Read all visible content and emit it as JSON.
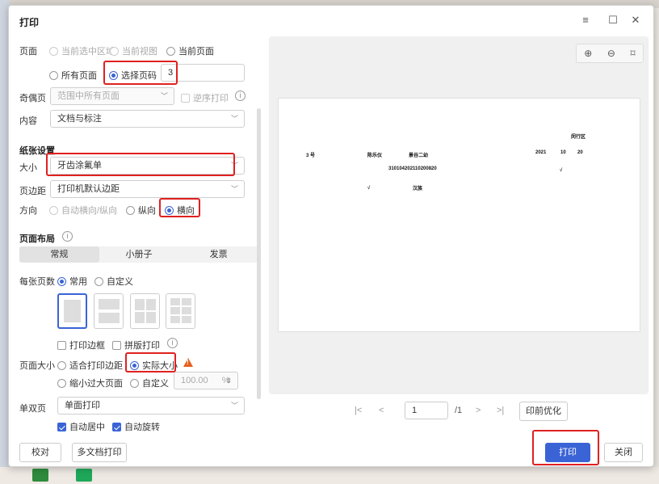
{
  "dialog": {
    "title": "打印",
    "menu_icon": "≡",
    "max_icon": "☐",
    "close_icon": "✕"
  },
  "page_range": {
    "label": "页面",
    "opt_selected_area": "当前选中区域",
    "opt_current_view": "当前视图",
    "opt_current_page": "当前页面",
    "opt_all_pages": "所有页面",
    "opt_select_pages": "选择页码",
    "pages_value": "3"
  },
  "odd_even": {
    "label": "奇偶页",
    "value": "范围中所有页面",
    "reverse_label": "逆序打印"
  },
  "content": {
    "label": "内容",
    "value": "文档与标注"
  },
  "paper": {
    "section": "纸张设置",
    "size_label": "大小",
    "size_value": "牙齿涂氟单",
    "margin_label": "页边距",
    "margin_value": "打印机默认边距",
    "orient_label": "方向",
    "orient_auto": "自动横向/纵向",
    "orient_portrait": "纵向",
    "orient_landscape": "横向"
  },
  "layout": {
    "section": "页面布局",
    "tabs": [
      "常规",
      "小册子",
      "发票"
    ],
    "pages_per_sheet_label": "每张页数",
    "opt_common": "常用",
    "opt_custom": "自定义",
    "print_border": "打印边框",
    "collate_print": "拼版打印"
  },
  "page_size": {
    "label": "页面大小",
    "opt_fit": "适合打印边距",
    "opt_actual": "实际大小",
    "opt_shrink": "缩小过大页面",
    "opt_custom": "自定义",
    "custom_value": "100.00",
    "custom_unit": "%"
  },
  "duplex": {
    "label": "单双页",
    "value": "单面打印",
    "auto_center": "自动居中",
    "auto_rotate": "自动旋转"
  },
  "preview": {
    "zoom_in": "⊕",
    "zoom_out": "⊖",
    "fit": "⌑",
    "cells": {
      "district": "闵行区",
      "number": "3 号",
      "name": "陈乐仪",
      "school": "景谷二幼",
      "year": "2021",
      "month": "10",
      "day": "20",
      "id": "310104202110200820",
      "check1": "√",
      "check2": "√",
      "ethnicity": "汉族"
    }
  },
  "pager": {
    "first": "|<",
    "prev": "<",
    "page": "1",
    "total": "/1",
    "next": ">",
    "last": ">|",
    "optimize": "印前优化"
  },
  "footer": {
    "proofread": "校对",
    "multi_doc": "多文档打印",
    "print": "打印",
    "close": "关闭"
  },
  "colors": {
    "accent": "#3a63d6",
    "highlight": "#e02020",
    "warning": "#e6601c"
  }
}
